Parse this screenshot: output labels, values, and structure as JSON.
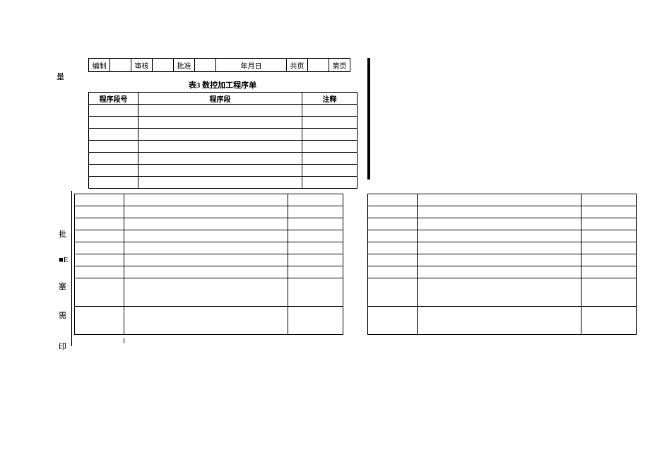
{
  "header": {
    "c1": "编制",
    "c2": "",
    "c3": "审核",
    "c4": "",
    "c5": "批准",
    "c6": "",
    "c7": "年月日",
    "c8": "共页",
    "c9": "",
    "c10": "第页"
  },
  "table3": {
    "title": "表3 数控加工程序单",
    "headers": {
      "col1": "程序段号",
      "col2": "程序段",
      "col3": "注释"
    }
  },
  "sideLabels": {
    "liang": "量",
    "pi": "批",
    "e": "■E",
    "sai": "塞",
    "xu": "需",
    "yin": "印"
  }
}
